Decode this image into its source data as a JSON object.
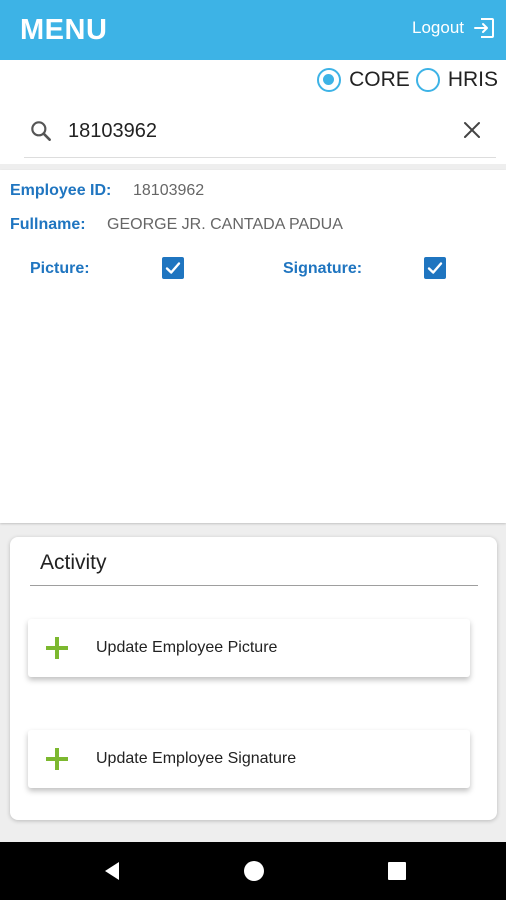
{
  "appbar": {
    "title": "MENU",
    "logout_label": "Logout",
    "logout_icon": "logout-icon"
  },
  "source_toggle": {
    "options": [
      {
        "label": "CORE",
        "selected": true
      },
      {
        "label": "HRIS",
        "selected": false
      }
    ]
  },
  "search": {
    "value": "18103962",
    "icon": "search-icon",
    "clear_icon": "close-icon"
  },
  "employee": {
    "id_label": "Employee ID:",
    "id_value": "18103962",
    "fullname_label": "Fullname:",
    "fullname_value": "GEORGE JR. CANTADA PADUA",
    "picture_label": "Picture:",
    "picture_checked": true,
    "signature_label": "Signature:",
    "signature_checked": true
  },
  "activity": {
    "title": "Activity",
    "actions": [
      {
        "label": "Update Employee Picture",
        "icon": "plus-icon"
      },
      {
        "label": "Update Employee Signature",
        "icon": "plus-icon"
      }
    ]
  },
  "colors": {
    "appbar": "#3db3e6",
    "label_blue": "#1f75c0",
    "plus_green": "#7cb82f"
  },
  "navbar": {
    "icons": [
      "back-icon",
      "home-icon",
      "recents-icon"
    ]
  }
}
